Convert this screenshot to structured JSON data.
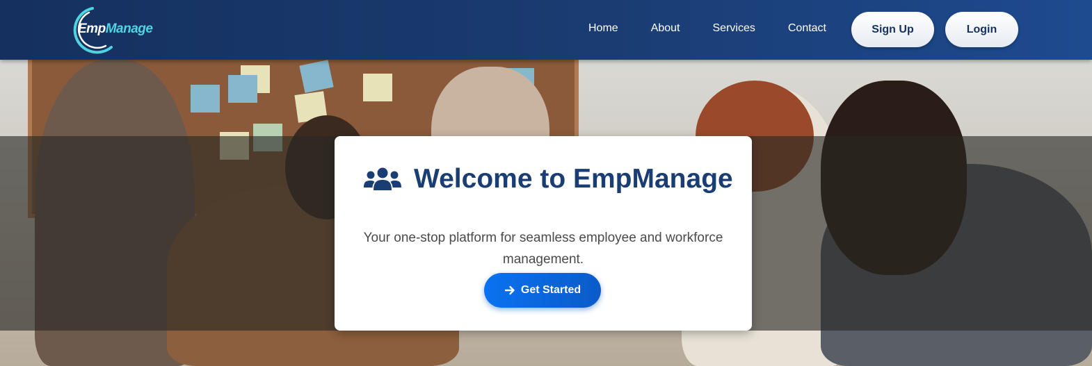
{
  "brand": {
    "logo_part1": "Emp",
    "logo_part2": "Manage"
  },
  "nav": {
    "links": [
      "Home",
      "About",
      "Services",
      "Contact"
    ],
    "signup_label": "Sign Up",
    "login_label": "Login"
  },
  "hero": {
    "title": "Welcome to EmpManage",
    "subtitle": "Your one-stop platform for seamless employee and workforce management.",
    "cta_label": "Get Started",
    "icon": "users-icon",
    "cta_icon": "arrow-right-icon"
  },
  "colors": {
    "navbar": "#1a3c72",
    "accent": "#0a6fe8",
    "title": "#1a3e73",
    "logo_accent": "#4fd3e0"
  }
}
